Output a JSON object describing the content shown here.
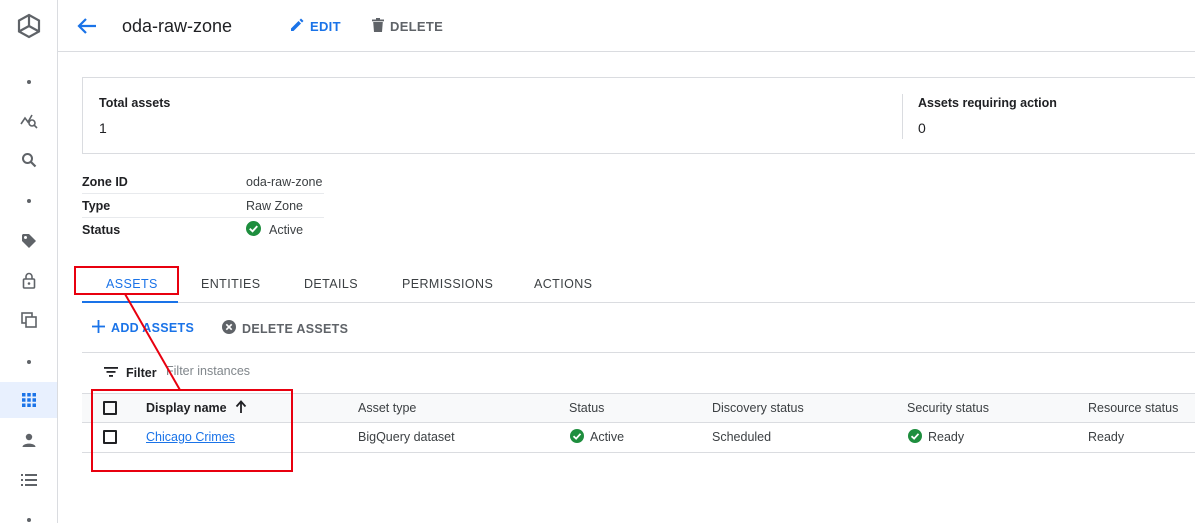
{
  "header": {
    "title": "oda-raw-zone",
    "edit_label": "EDIT",
    "delete_label": "DELETE"
  },
  "summary": {
    "total_assets_label": "Total assets",
    "total_assets_value": "1",
    "action_assets_label": "Assets requiring action",
    "action_assets_value": "0"
  },
  "details": {
    "zone_id_label": "Zone ID",
    "zone_id_value": "oda-raw-zone",
    "type_label": "Type",
    "type_value": "Raw Zone",
    "status_label": "Status",
    "status_value": "Active"
  },
  "tabs": [
    "ASSETS",
    "ENTITIES",
    "DETAILS",
    "PERMISSIONS",
    "ACTIONS"
  ],
  "actions": {
    "add_label": "ADD ASSETS",
    "delete_label": "DELETE ASSETS"
  },
  "filter": {
    "label": "Filter",
    "placeholder": "Filter instances"
  },
  "table": {
    "headers": [
      "Display name",
      "Asset type",
      "Status",
      "Discovery status",
      "Security status",
      "Resource status"
    ],
    "rows": [
      {
        "display_name": "Chicago Crimes",
        "asset_type": "BigQuery dataset",
        "status": "Active",
        "discovery_status": "Scheduled",
        "security_status": "Ready",
        "resource_status": "Ready"
      }
    ]
  },
  "colors": {
    "accent": "#1a73e8",
    "success": "#1e8e3e",
    "annotation": "#e8000f"
  },
  "icons": {
    "rail": [
      "dataplex-logo-icon",
      "dot-icon",
      "analytics-icon",
      "search-icon",
      "dot-icon",
      "tag-icon",
      "lock-icon",
      "copy-icon",
      "dot-icon",
      "grid-icon",
      "person-icon",
      "list-icon",
      "dot-icon"
    ]
  }
}
